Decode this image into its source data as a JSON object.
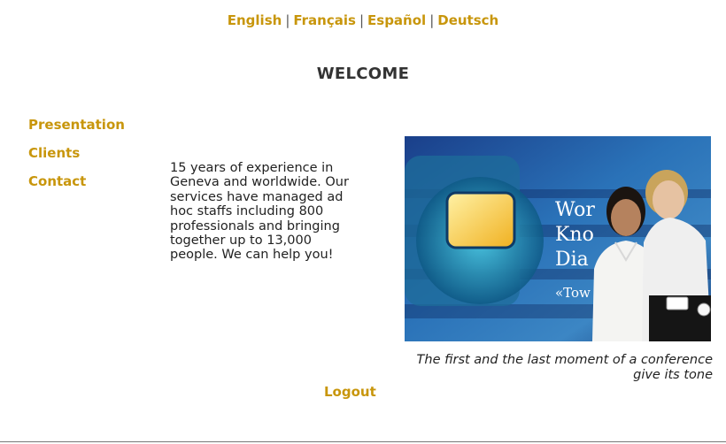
{
  "languages": [
    {
      "label": "English"
    },
    {
      "label": "Français"
    },
    {
      "label": "Español"
    },
    {
      "label": "Deutsch"
    }
  ],
  "language_separator": "|",
  "page_title": "WELCOME",
  "nav": {
    "items": [
      {
        "label": "Presentation"
      },
      {
        "label": "Clients"
      },
      {
        "label": "Contact"
      }
    ]
  },
  "intro_text": "15 years of experience in Geneva and worldwide. Our services have managed ad hoc staffs including 800 professionals and bringing together up to 13,000 people. We can help you!",
  "photo": {
    "banner_text_lines": [
      "Wor",
      "Kno",
      "Dia",
      "«Tow"
    ]
  },
  "caption": {
    "line1": "The first and the last moment of a conference",
    "line2": "give its tone"
  },
  "logout_label": "Logout",
  "colors": {
    "link": "#c8960c",
    "text": "#2b2b2b"
  }
}
